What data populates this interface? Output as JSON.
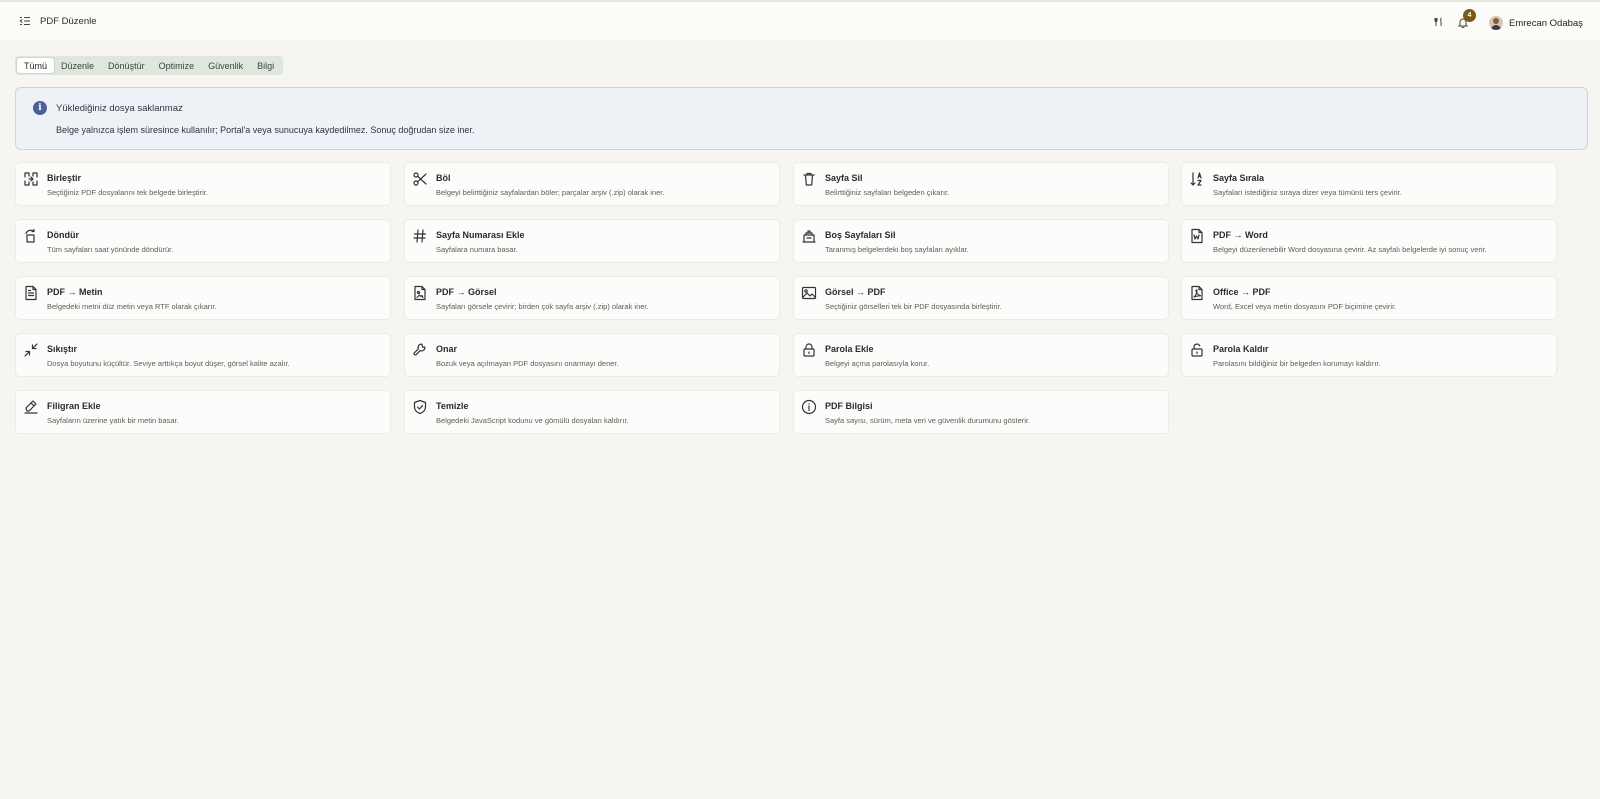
{
  "header": {
    "menu_icon": "menu-collapse-icon",
    "title": "PDF Düzenle",
    "tools_icon": "utensils-icon",
    "bell_icon": "bell-icon",
    "notification_count": "4",
    "user_name": "Emrecan Odabaş"
  },
  "tabs": [
    {
      "label": "Tümü",
      "active": true
    },
    {
      "label": "Düzenle",
      "active": false
    },
    {
      "label": "Dönüştür",
      "active": false
    },
    {
      "label": "Optimize",
      "active": false
    },
    {
      "label": "Güvenlik",
      "active": false
    },
    {
      "label": "Bilgi",
      "active": false
    }
  ],
  "info": {
    "icon": "info-icon",
    "title": "Yüklediğiniz dosya saklanmaz",
    "text": "Belge yalnızca işlem süresince kullanılır; Portal'a veya sunucuya kaydedilmez. Sonuç doğrudan size iner."
  },
  "tools": [
    {
      "icon": "merge-icon",
      "title": "Birleştir",
      "desc": "Seçtiğiniz PDF dosyalarını tek belgede birleştirir."
    },
    {
      "icon": "scissors-icon",
      "title": "Böl",
      "desc": "Belgeyi belirttiğiniz sayfalardan böler; parçalar arşiv (.zip) olarak iner."
    },
    {
      "icon": "trash-icon",
      "title": "Sayfa Sil",
      "desc": "Belirttiğiniz sayfaları belgeden çıkarır."
    },
    {
      "icon": "sort-az-icon",
      "title": "Sayfa Sırala",
      "desc": "Sayfaları istediğiniz sıraya dizer veya tümünü ters çevirir."
    },
    {
      "icon": "rotate-icon",
      "title": "Döndür",
      "desc": "Tüm sayfaları saat yönünde döndürür."
    },
    {
      "icon": "hash-icon",
      "title": "Sayfa Numarası Ekle",
      "desc": "Sayfalara numara basar."
    },
    {
      "icon": "eraser-icon",
      "title": "Boş Sayfaları Sil",
      "desc": "Taranmış belgelerdeki boş sayfaları ayıklar."
    },
    {
      "icon": "word-file-icon",
      "title": "PDF → Word",
      "desc": "Belgeyi düzenlenebilir Word dosyasına çevirir. Az sayfalı belgelerde iyi sonuç verir."
    },
    {
      "icon": "text-file-icon",
      "title": "PDF → Metin",
      "desc": "Belgedeki metni düz metin veya RTF olarak çıkarır."
    },
    {
      "icon": "image-file-icon",
      "title": "PDF → Görsel",
      "desc": "Sayfaları görsele çevirir; birden çok sayfa arşiv (.zip) olarak iner."
    },
    {
      "icon": "image-icon",
      "title": "Görsel → PDF",
      "desc": "Seçtiğiniz görselleri tek bir PDF dosyasında birleştirir."
    },
    {
      "icon": "pdf-file-icon",
      "title": "Office → PDF",
      "desc": "Word, Excel veya metin dosyasını PDF biçimine çevirir."
    },
    {
      "icon": "compress-icon",
      "title": "Sıkıştır",
      "desc": "Dosya boyutunu küçültür. Seviye arttıkça boyut düşer, görsel kalite azalır."
    },
    {
      "icon": "wrench-icon",
      "title": "Onar",
      "desc": "Bozuk veya açılmayan PDF dosyasını onarmayı dener."
    },
    {
      "icon": "lock-icon",
      "title": "Parola Ekle",
      "desc": "Belgeyi açma parolasıyla korur."
    },
    {
      "icon": "unlock-icon",
      "title": "Parola Kaldır",
      "desc": "Parolasını bildiğiniz bir belgeden korumayı kaldırır."
    },
    {
      "icon": "stamp-icon",
      "title": "Filigran Ekle",
      "desc": "Sayfaların üzerine yatık bir metin basar."
    },
    {
      "icon": "shield-check-icon",
      "title": "Temizle",
      "desc": "Belgedeki JavaScript kodunu ve gömülü dosyaları kaldırır."
    },
    {
      "icon": "info-circle-icon",
      "title": "PDF Bilgisi",
      "desc": "Sayfa sayısı, sürüm, meta veri ve güvenlik durumunu gösterir."
    }
  ],
  "colors": {
    "background": "#f6f5f1",
    "tab_strip": "#dfe6dc",
    "info_background": "#eef1f6",
    "info_accent": "#4b6096",
    "badge": "#7a5a14"
  }
}
